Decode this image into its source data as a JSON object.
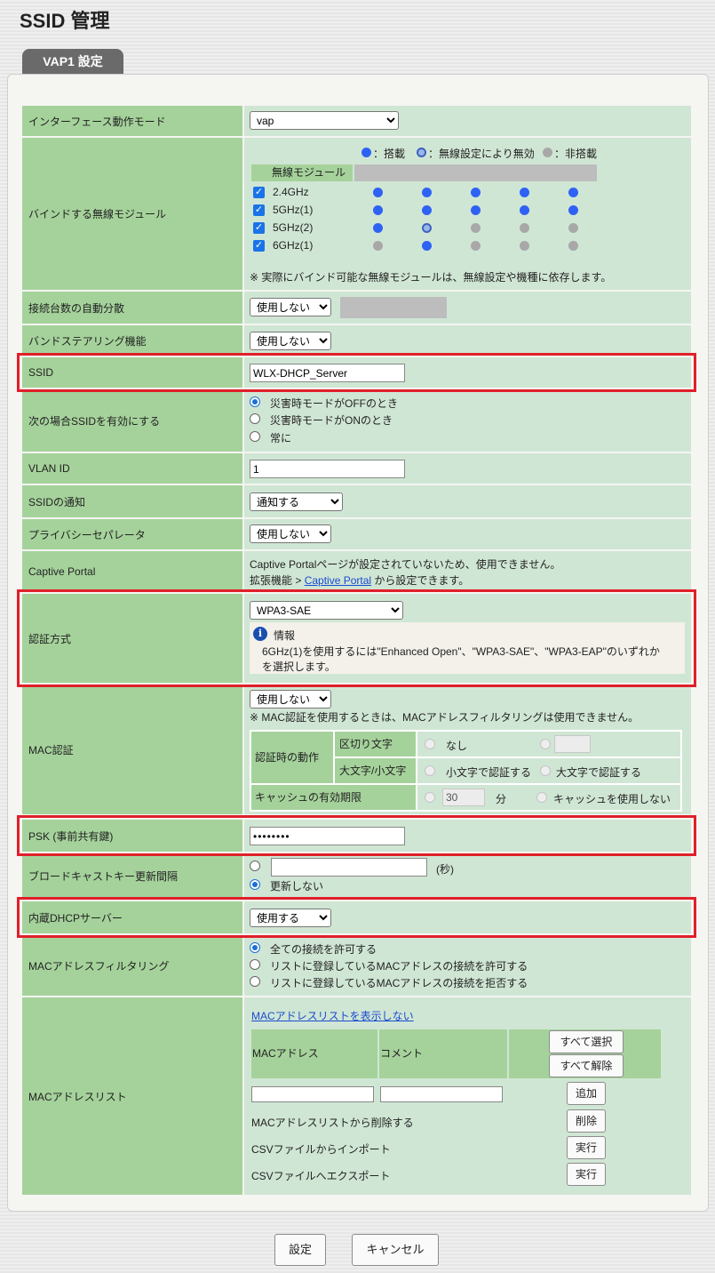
{
  "page": {
    "title": "SSID 管理",
    "tab": "VAP1 設定"
  },
  "rows": {
    "iface_mode": {
      "label": "インターフェース動作モード",
      "value": "vap"
    },
    "bind": {
      "label": "バインドする無線モジュール",
      "legend": {
        "on": "：搭載",
        "disabled": "：無線設定により無効",
        "off": "：非搭載"
      },
      "header": "無線モジュール",
      "modules": [
        {
          "name": "2.4GHz",
          "checked": true,
          "states": [
            "on",
            "on",
            "on",
            "on",
            "on"
          ]
        },
        {
          "name": "5GHz(1)",
          "checked": true,
          "states": [
            "on",
            "on",
            "on",
            "on",
            "on"
          ]
        },
        {
          "name": "5GHz(2)",
          "checked": true,
          "states": [
            "on",
            "disabled",
            "off",
            "off",
            "off"
          ]
        },
        {
          "name": "6GHz(1)",
          "checked": true,
          "states": [
            "off",
            "on",
            "off",
            "off",
            "off"
          ]
        }
      ],
      "note": "※ 実際にバインド可能な無線モジュールは、無線設定や機種に依存します。"
    },
    "auto_balance": {
      "label": "接続台数の自動分散",
      "value": "使用しない"
    },
    "band_steering": {
      "label": "バンドステアリング機能",
      "value": "使用しない"
    },
    "ssid": {
      "label": "SSID",
      "value": "WLX-DHCP_Server"
    },
    "enable_when": {
      "label": "次の場合SSIDを有効にする",
      "options": [
        "災害時モードがOFFのとき",
        "災害時モードがONのとき",
        "常に"
      ],
      "selected": 0
    },
    "vlan": {
      "label": "VLAN ID",
      "value": "1"
    },
    "ssid_notify": {
      "label": "SSIDの通知",
      "value": "通知する"
    },
    "privacy": {
      "label": "プライバシーセパレータ",
      "value": "使用しない"
    },
    "captive": {
      "label": "Captive Portal",
      "line1": "Captive Portalページが設定されていないため、使用できません。",
      "prefix": "拡張機能 > ",
      "link": "Captive Portal",
      "suffix": " から設定できます。"
    },
    "auth": {
      "label": "認証方式",
      "value": "WPA3-SAE",
      "info_title": "情報",
      "info_line1": "6GHz(1)を使用するには\"Enhanced Open\"、\"WPA3-SAE\"、\"WPA3-EAP\"のいずれか",
      "info_line2": "を選択します。"
    },
    "mac_auth": {
      "label": "MAC認証",
      "value": "使用しない",
      "note": "※ MAC認証を使用するときは、MACアドレスフィルタリングは使用できません。",
      "action_label": "認証時の動作",
      "delimiter_label": "区切り文字",
      "delimiter_none": "なし",
      "case_label": "大文字/小文字",
      "case_lower": "小文字で認証する",
      "case_upper": "大文字で認証する",
      "cache_label": "キャッシュの有効期限",
      "cache_value": "30",
      "cache_unit": "分",
      "cache_off": "キャッシュを使用しない"
    },
    "psk": {
      "label": "PSK (事前共有鍵)",
      "value": "••••••••"
    },
    "broadcast": {
      "label": "ブロードキャストキー更新間隔",
      "unit": "(秒)",
      "never": "更新しない"
    },
    "dhcp": {
      "label": "内蔵DHCPサーバー",
      "value": "使用する"
    },
    "mac_filter": {
      "label": "MACアドレスフィルタリング",
      "options": [
        "全ての接続を許可する",
        "リストに登録しているMACアドレスの接続を許可する",
        "リストに登録しているMACアドレスの接続を拒否する"
      ],
      "selected": 0
    },
    "mac_list": {
      "label": "MACアドレスリスト",
      "toggle_link": "MACアドレスリストを表示しない",
      "col_mac": "MACアドレス",
      "col_comment": "コメント",
      "select_all": "すべて選択",
      "clear_all": "すべて解除",
      "add": "追加",
      "delete_label": "MACアドレスリストから削除する",
      "delete": "削除",
      "import_label": "CSVファイルからインポート",
      "import": "実行",
      "export_label": "CSVファイルへエクスポート",
      "export": "実行"
    }
  },
  "footer": {
    "submit": "設定",
    "cancel": "キャンセル"
  },
  "colors": {
    "label_bg": "#a5d29b",
    "value_bg": "#d0e6d4",
    "highlight": "#e0202a",
    "accent": "#2e62f5"
  }
}
